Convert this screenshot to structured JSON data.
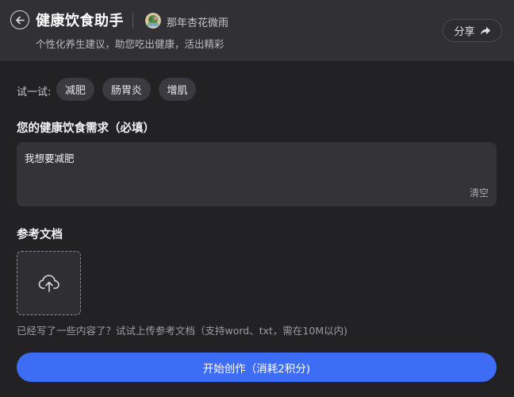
{
  "header": {
    "title": "健康饮食助手",
    "author": "那年杏花微雨",
    "subtitle": "个性化养生建议，助您吃出健康，活出精彩",
    "share_label": "分享"
  },
  "try": {
    "label": "试一试:",
    "chips": [
      "减肥",
      "肠胃炎",
      "增肌"
    ]
  },
  "needs": {
    "label": "您的健康饮食需求（必填）",
    "value": "我想要减肥",
    "clear_label": "清空"
  },
  "reference": {
    "label": "参考文档",
    "hint": "已经写了一些内容了？试试上传参考文档（支持word、txt，需在10M以内)"
  },
  "start_button": "开始创作（消耗2积分)",
  "colors": {
    "background": "#222225",
    "header_bg": "#303035",
    "accent": "#3d6df5",
    "chip_bg": "#3a3a40"
  }
}
